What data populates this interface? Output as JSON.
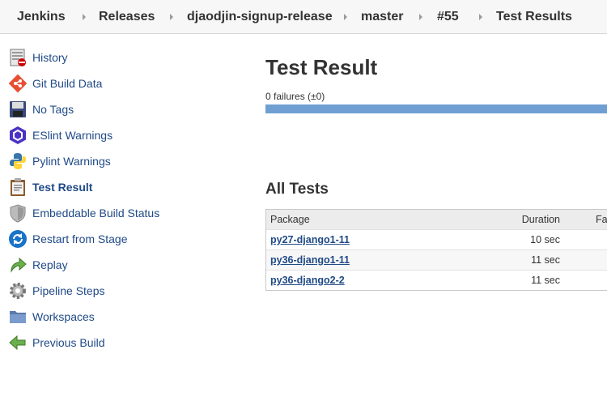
{
  "breadcrumbs": [
    "Jenkins",
    "Releases",
    "djaodjin-signup-release",
    "master",
    "#55",
    "Test Results"
  ],
  "sidebar": {
    "items": [
      {
        "label": "History",
        "icon": "history-icon"
      },
      {
        "label": "Git Build Data",
        "icon": "git-icon"
      },
      {
        "label": "No Tags",
        "icon": "floppy-icon"
      },
      {
        "label": "ESlint Warnings",
        "icon": "eslint-icon"
      },
      {
        "label": "Pylint Warnings",
        "icon": "python-icon"
      },
      {
        "label": "Test Result",
        "icon": "clipboard-icon",
        "active": true
      },
      {
        "label": "Embeddable Build Status",
        "icon": "shield-icon"
      },
      {
        "label": "Restart from Stage",
        "icon": "restart-icon"
      },
      {
        "label": "Replay",
        "icon": "replay-icon"
      },
      {
        "label": "Pipeline Steps",
        "icon": "gear-icon"
      },
      {
        "label": "Workspaces",
        "icon": "folder-icon"
      },
      {
        "label": "Previous Build",
        "icon": "arrow-left-icon"
      }
    ]
  },
  "main": {
    "title": "Test Result",
    "failures_text": "0 failures (±0)",
    "progress_fraction": 1.0,
    "all_tests_title": "All Tests",
    "table": {
      "headers": {
        "package": "Package",
        "duration": "Duration",
        "fail": "Fa"
      },
      "rows": [
        {
          "package": "py27-django1-11",
          "duration": "10 sec"
        },
        {
          "package": "py36-django1-11",
          "duration": "11 sec"
        },
        {
          "package": "py36-django2-2",
          "duration": "11 sec"
        }
      ]
    }
  },
  "colors": {
    "link": "#204a87",
    "progress": "#6f9fd2",
    "breadcrumb_bg": "#f7f7f7"
  }
}
